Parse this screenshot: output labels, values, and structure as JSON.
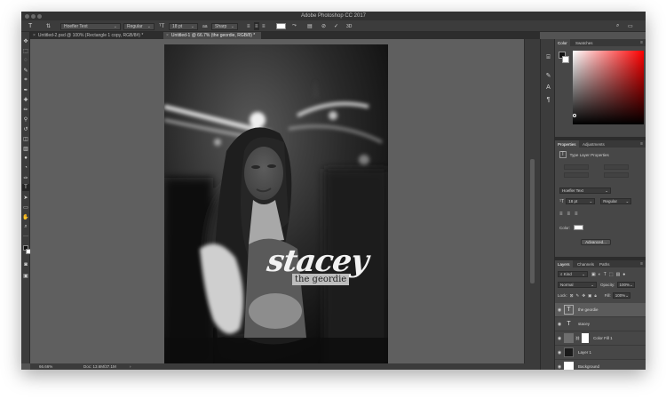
{
  "window": {
    "title": "Adobe Photoshop CC 2017"
  },
  "options_bar": {
    "tool_icon": "type-tool-icon",
    "font_family": "Hoefler Text",
    "font_style": "Regular",
    "font_size": "18 pt",
    "antialias_label": "aa",
    "antialias": "Sharp",
    "commit_label": "✓",
    "threed_label": "3D",
    "text_color": "#ffffff"
  },
  "tabs": [
    {
      "label": "Untitled-2.psd @ 100% (Rectangle 1 copy, RGB/8#) *",
      "active": false
    },
    {
      "label": "Untitled-1 @ 66.7% (the geordie, RGB/8) *",
      "active": true
    }
  ],
  "canvas": {
    "headline": "stacey",
    "subtitle": "the geordie"
  },
  "status": {
    "zoom": "66.66%",
    "doc": "Doc: 13.6M/37.1M",
    "arrow": "›"
  },
  "color_panel": {
    "tabs": [
      "Color",
      "Swatches"
    ]
  },
  "properties_panel": {
    "tabs": [
      "Properties",
      "Adjustments"
    ],
    "heading": "Type Layer Properties",
    "font_family": "Hoefler Text",
    "font_size": "18 pt",
    "font_style": "Regular",
    "color_label": "Color:",
    "advanced_button": "Advanced..."
  },
  "layers_panel": {
    "tabs": [
      "Layers",
      "Channels",
      "Paths"
    ],
    "filter": "Kind",
    "blend_mode": "Normal",
    "opacity_label": "Opacity:",
    "opacity": "100%",
    "lock_label": "Lock:",
    "fill_label": "Fill:",
    "fill": "100%",
    "layers": [
      {
        "name": "the geordie",
        "kind": "type",
        "selected": true
      },
      {
        "name": "stacey",
        "kind": "type",
        "selected": false
      },
      {
        "name": "Color Fill 1",
        "kind": "fill",
        "selected": false
      },
      {
        "name": "Layer 1",
        "kind": "pixel",
        "selected": false
      },
      {
        "name": "Background",
        "kind": "background",
        "selected": false
      }
    ]
  }
}
